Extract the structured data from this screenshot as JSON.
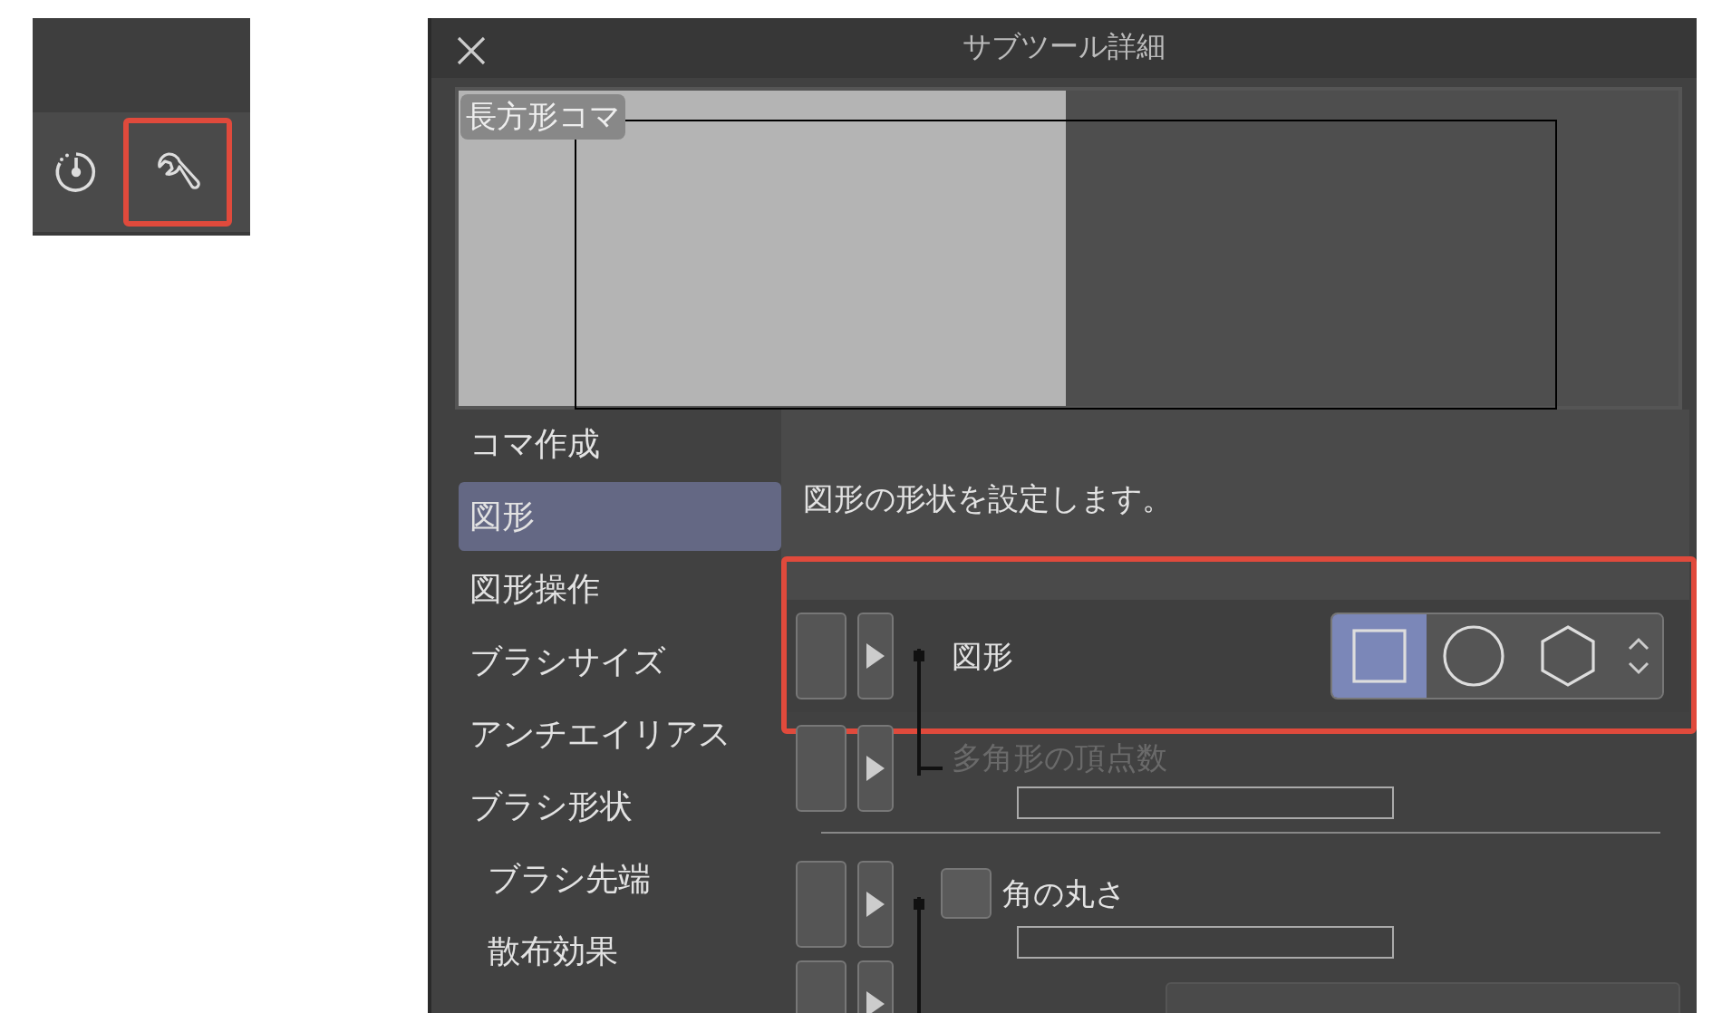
{
  "toolbar": {
    "buttons": [
      {
        "kind": "timer",
        "highlighted": false
      },
      {
        "kind": "wrench",
        "highlighted": true
      }
    ]
  },
  "dialog": {
    "title": "サブツール詳細",
    "preview": {
      "label": "長方形コマ"
    },
    "categories": [
      {
        "label": "コマ作成",
        "selected": false
      },
      {
        "label": "図形",
        "selected": true
      },
      {
        "label": "図形操作",
        "selected": false
      },
      {
        "label": "ブラシサイズ",
        "selected": false
      },
      {
        "label": "アンチエイリアス",
        "selected": false
      },
      {
        "label": "ブラシ形状",
        "selected": false,
        "children": [
          {
            "label": "ブラシ先端",
            "selected": false
          },
          {
            "label": "散布効果",
            "selected": false
          }
        ]
      }
    ],
    "description": "図形の形状を設定します。",
    "settings": [
      {
        "kind": "shape",
        "label": "図形",
        "highlighted": true,
        "connector": {
          "dot": true,
          "up": false,
          "down": true,
          "elbow": false
        },
        "options": [
          {
            "kind": "square",
            "selected": true
          },
          {
            "kind": "circle",
            "selected": false
          },
          {
            "kind": "hexagon",
            "selected": false
          }
        ]
      },
      {
        "kind": "slider",
        "label": "多角形の頂点数",
        "disabled": true,
        "connector": {
          "dot": false,
          "up": true,
          "down": false,
          "elbow": true
        }
      },
      {
        "kind": "divider"
      },
      {
        "kind": "checkbox-slider",
        "label": "角の丸さ",
        "checked": false,
        "connector": {
          "dot": true,
          "up": false,
          "down": true,
          "elbow": false
        }
      },
      {
        "kind": "blank",
        "connector": {
          "dot": false,
          "up": true,
          "down": true,
          "elbow": false
        }
      }
    ]
  }
}
